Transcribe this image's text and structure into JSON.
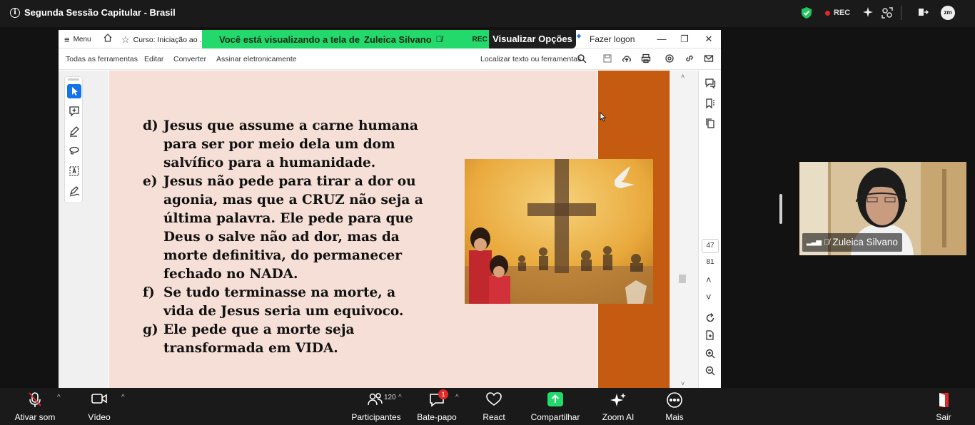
{
  "meeting": {
    "title": "Segunda Sessão Capitular - Brasil",
    "rec_label": "REC"
  },
  "acrobat": {
    "menu_label": "Menu",
    "tab_label": "Curso: Iniciação ao ...",
    "login_label": "Fazer logon",
    "tools": {
      "all_tools": "Todas as ferramentas",
      "edit": "Editar",
      "convert": "Converter",
      "sign": "Assinar eletronicamente",
      "search": "Localizar texto ou ferramentas"
    },
    "page_current": "47",
    "page_total": "81"
  },
  "share_banner": {
    "prefix": "Você está visualizando a tela de",
    "presenter": "Zuleica Silvano",
    "rec": "REC",
    "view_options": "Visualizar Opções"
  },
  "slide": {
    "items": [
      {
        "label": "d)",
        "lines": [
          "Jesus que assume a carne humana",
          "para ser por meio dela um dom",
          "salvífico para a humanidade."
        ]
      },
      {
        "label": "e)",
        "lines": [
          "Jesus não pede para tirar a dor ou",
          "agonia, mas que a CRUZ não seja a",
          "última palavra. Ele pede para que",
          "Deus o salve não ad dor, mas da",
          "morte definitiva, do permanecer",
          "fechado no NADA."
        ]
      },
      {
        "label": "f)",
        "lines": [
          "Se tudo terminasse na morte, a",
          "vida de Jesus seria um equivoco."
        ]
      },
      {
        "label": "g)",
        "lines": [
          "Ele pede que a morte seja",
          "transformada em VIDA."
        ]
      }
    ]
  },
  "video": {
    "name": "Zuleica Silvano"
  },
  "bottombar": {
    "audio": "Ativar som",
    "video": "Vídeo",
    "participants": "Participantes",
    "participants_count": "120",
    "chat": "Bate-papo",
    "chat_badge": "1",
    "react": "React",
    "share": "Compartilhar",
    "zoom_ai": "Zoom AI",
    "more": "Mais",
    "leave": "Sair"
  },
  "colors": {
    "share_green": "#23d96b",
    "slide_bg": "#f5dfd6",
    "slide_stripe": "#c55a11",
    "rec_dot": "#e02828",
    "shield_green": "#22c55e"
  }
}
